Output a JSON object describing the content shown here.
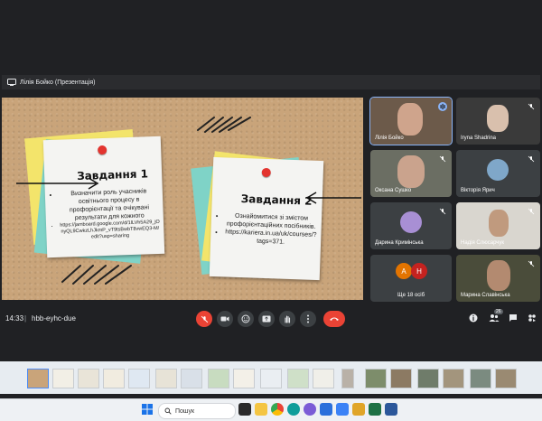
{
  "presenter_bar": {
    "label": "Лілія Бойко (Презентація)"
  },
  "slide": {
    "note1": {
      "title": "Завдання 1",
      "bullet_main": "Визначити роль учасників освітнього процесу в профорієнтації та очікувані результати для кожного",
      "bullet_link": "https://jamboard.google.com/d/1lLVh5A29_jOnyQL9CwkzLhJkmP_vT9tsBwbT8vwEQ3-M/edit?usp=sharing"
    },
    "note2": {
      "title": "Завдання 2",
      "bullet_main": "Ознайомитися зі змістом профорієнтаційних посібників.",
      "bullet_link": "https://kariera.in.ua/uk/courses/?tags=371."
    }
  },
  "participants": [
    {
      "name": "Лілія Бойко",
      "speaking": true
    },
    {
      "name": "Iryna Shadrina",
      "muted": true
    },
    {
      "name": "Оксана Сушко",
      "muted": true
    },
    {
      "name": "Вікторія Ярич",
      "muted": true
    },
    {
      "name": "Дарина Кримінська",
      "muted": true
    },
    {
      "name": "Надія Слюсарчук",
      "muted": true
    },
    {
      "name": "Ще 18 осіб",
      "avatars": [
        "А",
        "Н"
      ],
      "avatar_colors": [
        "#e37400",
        "#c5221f"
      ]
    },
    {
      "name": "Марина Славінська",
      "muted": true
    }
  ],
  "controls": {
    "time": "14:33",
    "separator": "|",
    "meeting_code": "hbb-eyhc-due",
    "people_count": "26"
  },
  "taskbar": {
    "search_placeholder": "Пошук"
  },
  "colors": {
    "background": "#202124",
    "tile": "#3c4043",
    "red": "#ea4335",
    "accent": "#8ab4f8",
    "cork": "#c9a47a"
  }
}
